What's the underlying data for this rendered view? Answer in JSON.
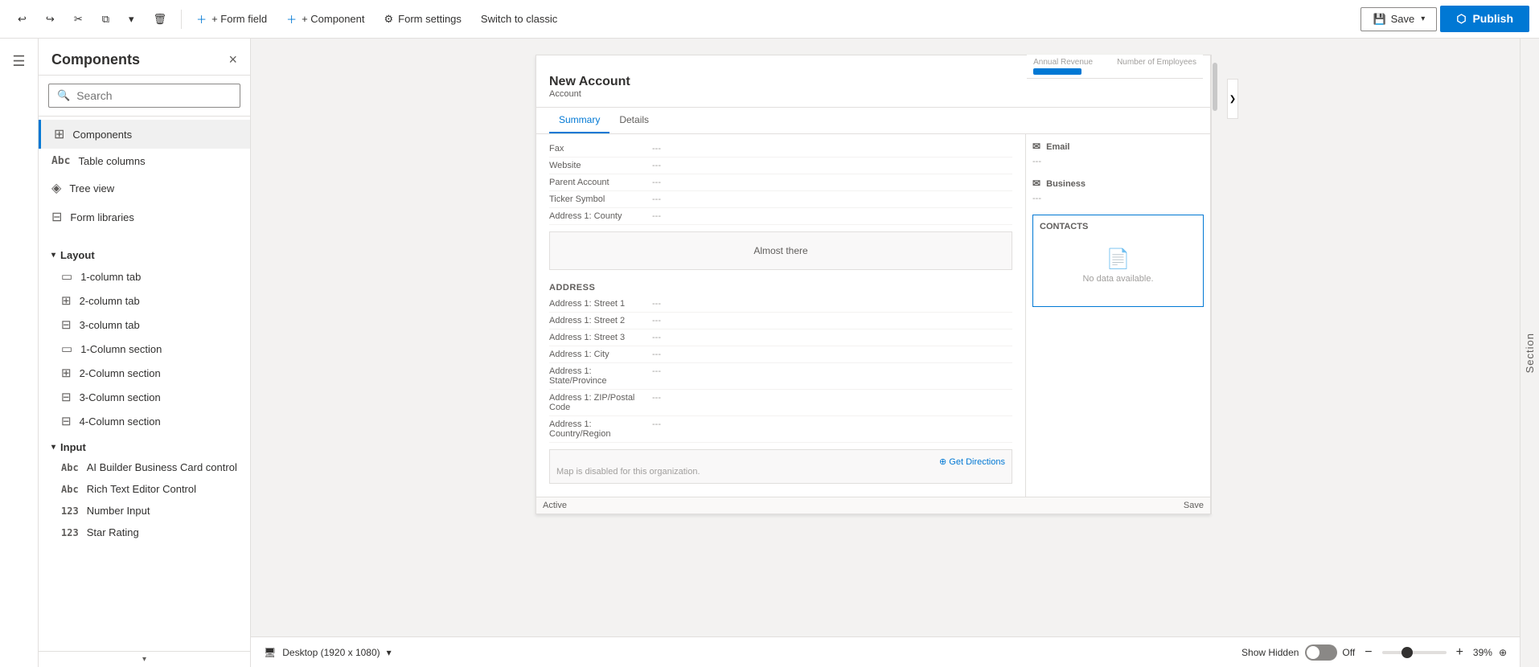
{
  "toolbar": {
    "undo_label": "Undo",
    "redo_label": "Redo",
    "cut_label": "Cut",
    "copy_label": "Copy",
    "paste_label": "Paste",
    "delete_label": "Delete",
    "form_field_label": "+ Form field",
    "component_label": "+ Component",
    "form_settings_label": "Form settings",
    "switch_classic_label": "Switch to classic",
    "save_label": "Save",
    "publish_label": "Publish"
  },
  "sidebar": {
    "title": "Components",
    "close_label": "×",
    "search_placeholder": "Search",
    "nav_items": [
      {
        "id": "components",
        "label": "Components",
        "icon": "⊞",
        "active": true
      },
      {
        "id": "table-columns",
        "label": "Table columns",
        "icon": "Abc",
        "active": false
      },
      {
        "id": "tree-view",
        "label": "Tree view",
        "icon": "◈",
        "active": false
      },
      {
        "id": "form-libraries",
        "label": "Form libraries",
        "icon": "⊟",
        "active": false
      }
    ],
    "sections": {
      "layout": {
        "label": "Layout",
        "items": [
          {
            "id": "1-column-tab",
            "label": "1-column tab",
            "icon": "▭"
          },
          {
            "id": "2-column-tab",
            "label": "2-column tab",
            "icon": "⊞"
          },
          {
            "id": "3-column-tab",
            "label": "3-column tab",
            "icon": "⊟"
          },
          {
            "id": "1-column-section",
            "label": "1-Column section",
            "icon": "▭"
          },
          {
            "id": "2-column-section",
            "label": "2-Column section",
            "icon": "⊞"
          },
          {
            "id": "3-column-section",
            "label": "3-Column section",
            "icon": "⊟"
          },
          {
            "id": "4-column-section",
            "label": "4-Column section",
            "icon": "⊟"
          }
        ]
      },
      "input": {
        "label": "Input",
        "items": [
          {
            "id": "ai-builder",
            "label": "AI Builder Business Card control",
            "icon": "Abc"
          },
          {
            "id": "rich-text",
            "label": "Rich Text Editor Control",
            "icon": "Abc"
          },
          {
            "id": "number-input",
            "label": "Number Input",
            "icon": "123"
          },
          {
            "id": "star-rating",
            "label": "Star Rating",
            "icon": "123"
          }
        ]
      }
    }
  },
  "form": {
    "title": "New Account",
    "subtitle": "Account",
    "tabs": [
      "Summary",
      "Details"
    ],
    "active_tab": "Summary",
    "fields": [
      {
        "label": "Fax",
        "value": "---"
      },
      {
        "label": "Website",
        "value": "---"
      },
      {
        "label": "Parent Account",
        "value": "---"
      },
      {
        "label": "Ticker Symbol",
        "value": "---"
      },
      {
        "label": "Address 1: County",
        "value": "---"
      }
    ],
    "address_section": {
      "title": "ADDRESS",
      "fields": [
        {
          "label": "Address 1: Street 1",
          "value": "---"
        },
        {
          "label": "Address 1: Street 2",
          "value": "---"
        },
        {
          "label": "Address 1: Street 3",
          "value": "---"
        },
        {
          "label": "Address 1: City",
          "value": "---"
        },
        {
          "label": "Address 1: State/Province",
          "value": "---"
        },
        {
          "label": "Address 1: ZIP/Postal Code",
          "value": "---"
        },
        {
          "label": "Address 1: Country/Region",
          "value": "---"
        }
      ]
    },
    "map_disabled": "Map is disabled for this organization.",
    "get_directions": "Get Directions",
    "almost_there": "Almost there",
    "side_panel": {
      "annual_revenue_label": "Annual Revenue",
      "employees_label": "Number of Employees",
      "email_label": "Email",
      "email_value": "---",
      "business_label": "Business",
      "business_value": "---",
      "contacts_title": "CONTACTS",
      "no_data": "No data available."
    },
    "status_bar": {
      "left": "Active",
      "right": "Save"
    }
  },
  "status_bar": {
    "device_label": "Desktop (1920 x 1080)",
    "show_hidden_label": "Show Hidden",
    "toggle_state": "Off",
    "zoom_minus": "−",
    "zoom_plus": "+",
    "zoom_level": "39%",
    "reset_icon": "⊕",
    "chevron_label": "⌄"
  },
  "right_panel": {
    "label": "Section"
  },
  "canvas_chevron": "❯"
}
